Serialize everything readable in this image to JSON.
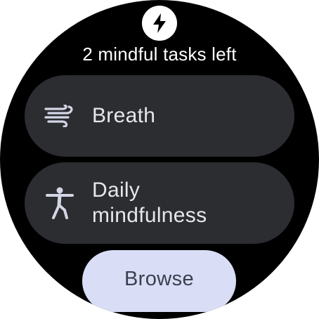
{
  "header": {
    "icon": "lightning-bolt-icon",
    "title": "2 mindful tasks left"
  },
  "tasks": [
    {
      "label": "Breath",
      "icon": "wind-icon"
    },
    {
      "label": "Daily\nmindfulness",
      "icon": "person-stretching-icon"
    }
  ],
  "browse": {
    "label": "Browse"
  },
  "colors": {
    "background": "#000000",
    "chip": "#2c2d31",
    "chip_text": "#e6e7ec",
    "button": "#d9def6",
    "button_text": "#3b3f4e"
  }
}
